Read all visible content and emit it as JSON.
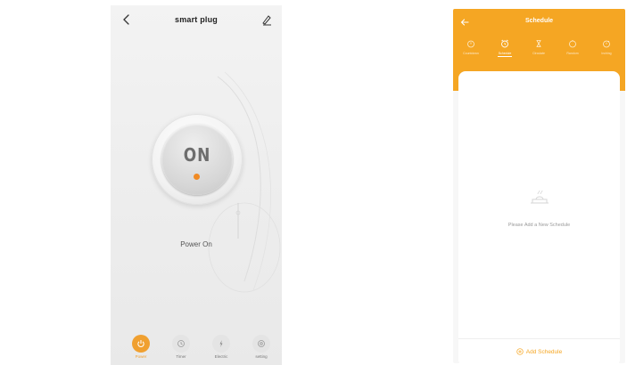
{
  "left_screen": {
    "title": "smart plug",
    "power_button_label": "ON",
    "status": "Power On",
    "nav": [
      {
        "label": "Power",
        "icon": "power-icon",
        "active": true
      },
      {
        "label": "Timer",
        "icon": "clock-icon",
        "active": false
      },
      {
        "label": "Electric",
        "icon": "lightning-icon",
        "active": false
      },
      {
        "label": "setting",
        "icon": "gear-icon",
        "active": false
      }
    ]
  },
  "right_screen": {
    "title": "Schedule",
    "tabs": [
      {
        "label": "Countdown",
        "icon": "countdown-icon"
      },
      {
        "label": "Schedule",
        "icon": "alarm-clock-icon",
        "active": true
      },
      {
        "label": "Circulate",
        "icon": "hourglass-icon"
      },
      {
        "label": "Random",
        "icon": "timer-icon"
      },
      {
        "label": "Inching",
        "icon": "stopwatch-icon"
      }
    ],
    "empty_message": "Please Add a New Schedule",
    "add_button_label": "Add Schedule"
  },
  "colors": {
    "accent": "#f5a623",
    "power_dot": "#f08a24",
    "left_background": "#eeeeee"
  }
}
